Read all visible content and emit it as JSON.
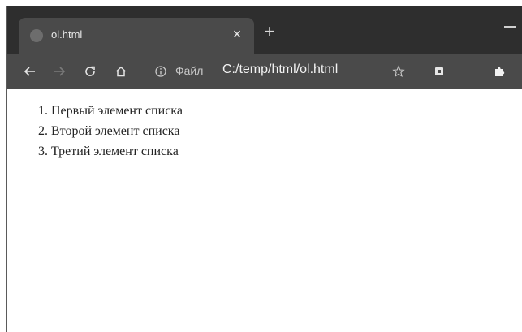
{
  "tab": {
    "title": "ol.html",
    "close_label": "×",
    "new_tab_label": "+"
  },
  "toolbar": {
    "omnibox_scheme": "Файл",
    "omnibox_url": "C:/temp/html/ol.html"
  },
  "page": {
    "ordered_list": [
      "1. Первый элемент списка",
      "2. Второй элемент списка",
      "3. Третий элемент списка"
    ]
  },
  "icons": {
    "back": "back-arrow-icon",
    "forward": "forward-arrow-icon",
    "reload": "reload-icon",
    "home": "home-icon",
    "info": "info-icon",
    "bookmark": "star-icon",
    "extension": "extension-badge-icon",
    "extensions_menu": "puzzle-icon"
  },
  "colors": {
    "tab_strip": "#2e2e2e",
    "toolbar": "#4a4a4a",
    "page_background": "#ffffff",
    "list_text": "#222222"
  }
}
